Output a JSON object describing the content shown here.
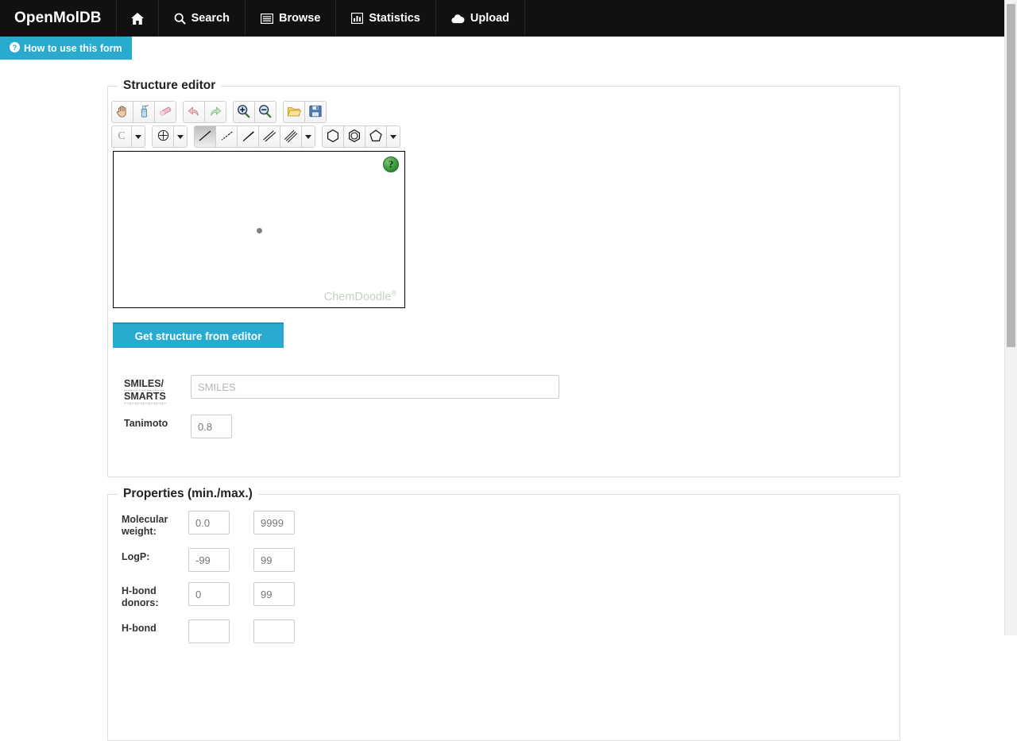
{
  "navbar": {
    "brand": "OpenMolDB",
    "items": [
      {
        "label": "",
        "icon": "home-icon",
        "name": "nav-home"
      },
      {
        "label": "Search",
        "icon": "search-icon",
        "name": "nav-search"
      },
      {
        "label": "Browse",
        "icon": "list-icon",
        "name": "nav-browse"
      },
      {
        "label": "Statistics",
        "icon": "bar-chart-icon",
        "name": "nav-statistics"
      },
      {
        "label": "Upload",
        "icon": "cloud-upload-icon",
        "name": "nav-upload"
      }
    ]
  },
  "howto": {
    "label": "How to use this form",
    "icon": "question-circle-icon",
    "color": "#29abd0"
  },
  "structure_editor": {
    "legend": "Structure editor",
    "toolbar_row1": [
      {
        "name": "pan-tool-button",
        "icon": "hand-icon",
        "title": "Pan"
      },
      {
        "name": "select-tool-button",
        "icon": "lasso-spray-icon",
        "title": "Select"
      },
      {
        "name": "erase-tool-button",
        "icon": "eraser-icon",
        "title": "Erase"
      },
      {
        "name": "undo-button",
        "icon": "undo-arrow-icon",
        "title": "Undo"
      },
      {
        "name": "redo-button",
        "icon": "redo-arrow-icon",
        "title": "Redo"
      },
      {
        "name": "zoom-in-button",
        "icon": "magnifier-plus-icon",
        "title": "Zoom in"
      },
      {
        "name": "zoom-out-button",
        "icon": "magnifier-minus-icon",
        "title": "Zoom out"
      },
      {
        "name": "open-file-button",
        "icon": "folder-open-icon",
        "title": "Open"
      },
      {
        "name": "save-file-button",
        "icon": "floppy-disk-icon",
        "title": "Save"
      }
    ],
    "element_button": {
      "label": "C",
      "name": "element-carbon-button"
    },
    "toolbar_row2": [
      {
        "name": "charge-tool-button",
        "icon": "plus-circle-icon",
        "title": "Charge"
      },
      {
        "name": "bond-single-button",
        "icon": "single-bond-icon",
        "title": "Single bond",
        "active": true
      },
      {
        "name": "bond-hash-button",
        "icon": "hashed-bond-icon",
        "title": "Hashed bond"
      },
      {
        "name": "bond-wedge-button",
        "icon": "wedge-bond-icon",
        "title": "Wedge bond"
      },
      {
        "name": "bond-double-button",
        "icon": "double-bond-icon",
        "title": "Double bond"
      },
      {
        "name": "bond-triple-button",
        "icon": "triple-bond-icon",
        "title": "Triple bond"
      },
      {
        "name": "ring-hexagon-button",
        "icon": "hexagon-icon",
        "title": "Cyclohexane"
      },
      {
        "name": "ring-benzene-button",
        "icon": "benzene-icon",
        "title": "Benzene"
      },
      {
        "name": "ring-pentagon-button",
        "icon": "pentagon-icon",
        "title": "Cyclopentane"
      }
    ],
    "canvas": {
      "help_label": "?",
      "watermark": "ChemDoodle",
      "watermark_mark": "®"
    },
    "get_structure_button": "Get structure from editor",
    "fields": [
      {
        "label_line1": "SMILES/",
        "label_line2": "SMARTS",
        "placeholder": "SMILES",
        "value": "",
        "name": "smiles-smarts-input"
      },
      {
        "label_line1": "Tanimoto",
        "label_line2": "",
        "placeholder": "",
        "value": "0.8",
        "name": "tanimoto-input"
      }
    ]
  },
  "properties": {
    "legend": "Properties (min./max.)",
    "rows": [
      {
        "label_line1": "Molecular",
        "label_line2": "weight:",
        "min": "0.0",
        "max": "9999",
        "name_min": "molecular-weight-min-input",
        "name_max": "molecular-weight-max-input"
      },
      {
        "label_line1": "LogP:",
        "label_line2": "",
        "min": "-99",
        "max": "99",
        "name_min": "logp-min-input",
        "name_max": "logp-max-input"
      },
      {
        "label_line1": "H-bond",
        "label_line2": "donors:",
        "min": "0",
        "max": "99",
        "name_min": "hbond-donors-min-input",
        "name_max": "hbond-donors-max-input"
      },
      {
        "label_line1": "H-bond",
        "label_line2": "",
        "min": "",
        "max": "",
        "name_min": "hbond-acceptors-min-input",
        "name_max": "hbond-acceptors-max-input"
      }
    ]
  },
  "scrollbar": {
    "thumb_top_pct": 0.6,
    "thumb_height_pct": 54
  }
}
